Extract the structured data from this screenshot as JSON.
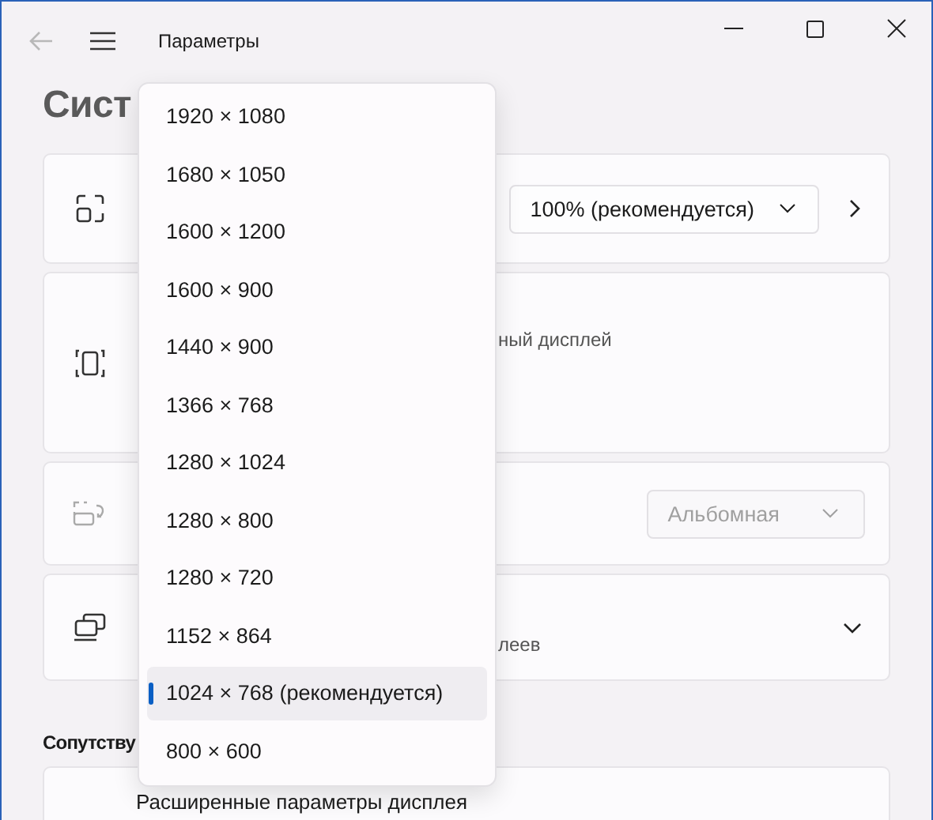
{
  "window": {
    "title": "Параметры",
    "back_disabled": true
  },
  "heading": "Сист",
  "cards": [
    {
      "kind": "select",
      "select": {
        "value": "100% (рекомендуется)",
        "disabled": false
      }
    },
    {
      "kind": "text",
      "text": "ный дисплей"
    },
    {
      "kind": "select",
      "select": {
        "value": "Альбомная",
        "disabled": true
      }
    },
    {
      "kind": "expand",
      "text": "леев"
    }
  ],
  "related": {
    "heading": "Сопутству",
    "items": [
      "Расширенные параметры дисплея"
    ]
  },
  "dropdown": {
    "items": [
      {
        "label": "1920 × 1080",
        "selected": false
      },
      {
        "label": "1680 × 1050",
        "selected": false
      },
      {
        "label": "1600 × 1200",
        "selected": false
      },
      {
        "label": "1600 × 900",
        "selected": false
      },
      {
        "label": "1440 × 900",
        "selected": false
      },
      {
        "label": "1366 × 768",
        "selected": false
      },
      {
        "label": "1280 × 1024",
        "selected": false
      },
      {
        "label": "1280 × 800",
        "selected": false
      },
      {
        "label": "1280 × 720",
        "selected": false
      },
      {
        "label": "1152 × 864",
        "selected": false
      },
      {
        "label": "1024 × 768 (рекомендуется)",
        "selected": true
      },
      {
        "label": "800 × 600",
        "selected": false
      }
    ]
  }
}
